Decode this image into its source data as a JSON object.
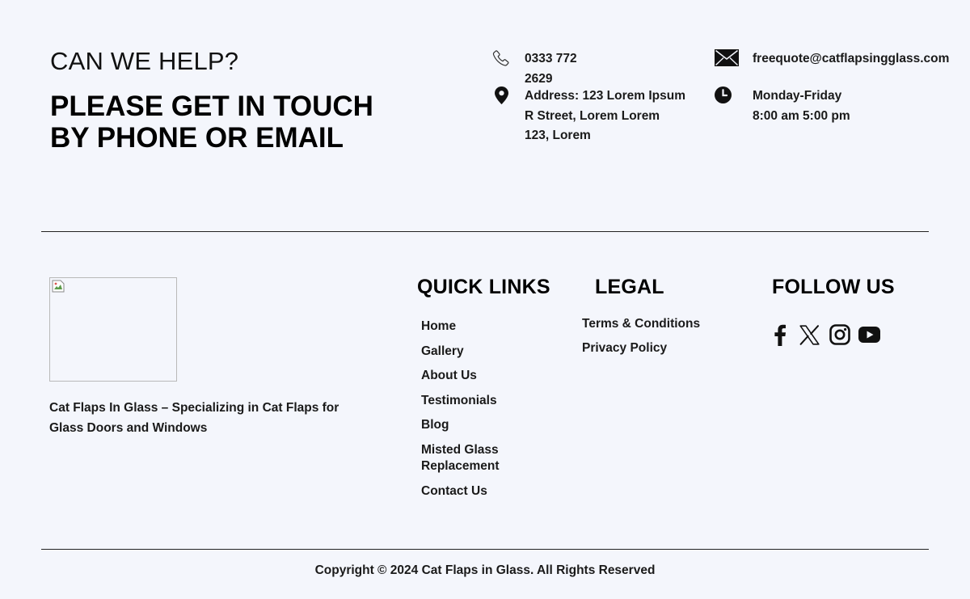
{
  "help": {
    "kicker": "CAN WE HELP?",
    "title": "PLEASE GET IN TOUCH BY PHONE OR EMAIL"
  },
  "contact": {
    "phone_line1": "0333 772",
    "phone_line2": "2629",
    "email": "freequote@catflapsingglass.com",
    "address_line1": "Address: 123 Lorem Ipsum",
    "address_line2": "R Street, Lorem Lorem",
    "address_line3": "123, Lorem",
    "hours_line1": "Monday-Friday",
    "hours_line2": "8:00 am 5:00 pm",
    "icons": [
      "phone-icon",
      "map-pin-icon",
      "envelope-icon",
      "clock-icon"
    ]
  },
  "brand": {
    "tagline": "Cat Flaps In Glass – Specializing in Cat Flaps for Glass Doors and Windows"
  },
  "quick_links": {
    "heading": "QUICK LINKS",
    "items": [
      "Home",
      "Gallery",
      "About Us",
      "Testimonials",
      "Blog",
      "Misted Glass Replacement",
      "Contact Us"
    ]
  },
  "legal": {
    "heading": "LEGAL",
    "items": [
      "Terms & Conditions",
      "Privacy Policy"
    ]
  },
  "follow": {
    "heading": "FOLLOW US",
    "icons": [
      "facebook-icon",
      "x-twitter-icon",
      "instagram-icon",
      "youtube-icon"
    ]
  },
  "footer": {
    "copyright": "Copyright © 2024 Cat Flaps in Glass. All Rights Reserved"
  },
  "colors": {
    "background": "#f4f6fc",
    "text": "#111111",
    "divider": "#222222"
  }
}
